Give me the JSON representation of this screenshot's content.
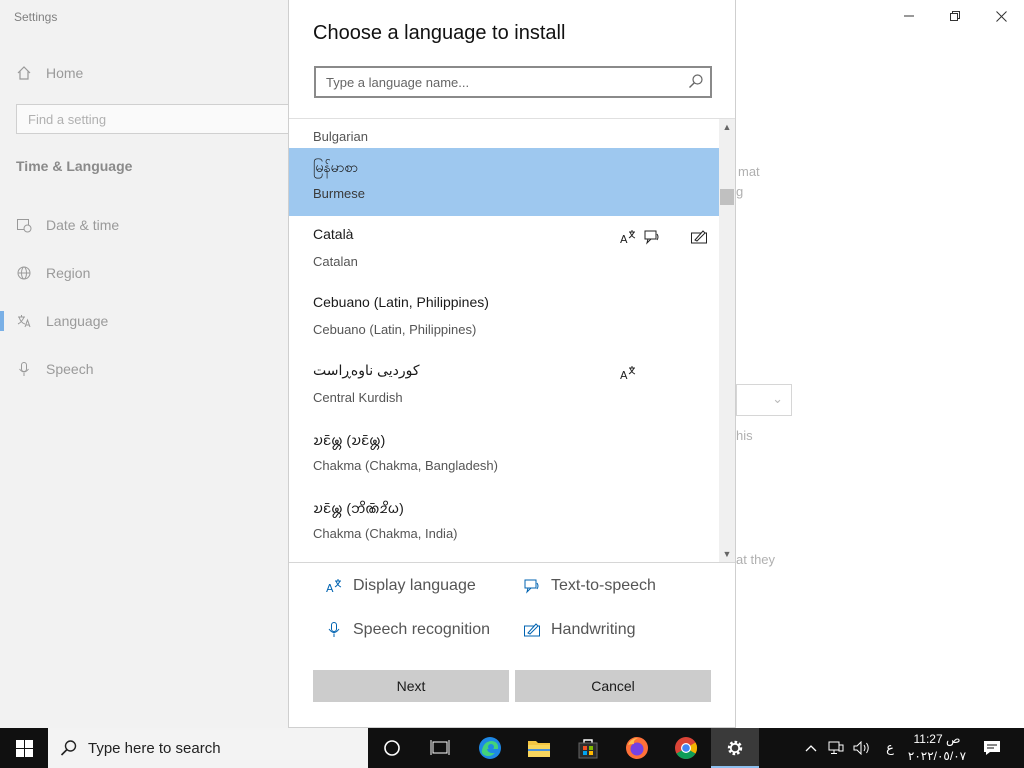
{
  "settings": {
    "window_title": "Settings",
    "home_label": "Home",
    "find_placeholder": "Find a setting",
    "section_title": "Time & Language",
    "nav": [
      {
        "label": "Date & time"
      },
      {
        "label": "Region"
      },
      {
        "label": "Language",
        "active": true
      },
      {
        "label": "Speech"
      }
    ],
    "bg_fragments": [
      "mat",
      "g",
      "his",
      "at they"
    ]
  },
  "dialog": {
    "title": "Choose a language to install",
    "search_placeholder": "Type a language name...",
    "languages": [
      {
        "native": "",
        "english": "Bulgarian",
        "features": []
      },
      {
        "native": "မြန်မာစာ",
        "english": "Burmese",
        "selected": true,
        "features": []
      },
      {
        "native": "Català",
        "english": "Catalan",
        "features": [
          "display-language",
          "text-to-speech",
          "handwriting"
        ]
      },
      {
        "native": "Cebuano (Latin, Philippines)",
        "english": "Cebuano (Latin, Philippines)",
        "features": []
      },
      {
        "native": "کوردیی ناوەڕاست",
        "english": "Central Kurdish",
        "features": [
          "display-language"
        ]
      },
      {
        "native": "𑄌𑄋𑄴𑄟𑄳𑄦 (𑄌𑄋𑄴𑄟𑄳𑄦)",
        "english": "Chakma (Chakma, Bangladesh)",
        "features": []
      },
      {
        "native": "𑄌𑄋𑄴𑄟𑄳𑄦 (𑄃𑄨𑄚𑄴𑄓𑄨𑄠)",
        "english": "Chakma (Chakma, India)",
        "features": []
      }
    ],
    "legend": {
      "display_language": "Display language",
      "text_to_speech": "Text-to-speech",
      "speech_recognition": "Speech recognition",
      "handwriting": "Handwriting"
    },
    "buttons": {
      "next": "Next",
      "cancel": "Cancel"
    }
  },
  "taskbar": {
    "search_text": "Type here to search",
    "clock_time": "11:27 ص",
    "clock_date": "٢٠٢٢/٠٥/٠٧",
    "keyboard_indicator": "ع",
    "active_app": "settings-gear-icon"
  },
  "colors": {
    "selected_row": "#9ec8ef",
    "accent": "#0078d7",
    "taskbar": "#101010",
    "button": "#cccccc"
  }
}
